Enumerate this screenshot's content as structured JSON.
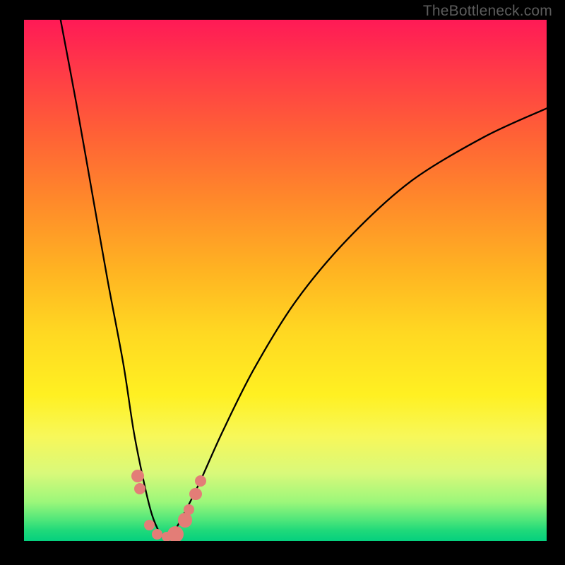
{
  "watermark": "TheBottleneck.com",
  "colors": {
    "frame": "#000000",
    "curve_stroke": "#000000",
    "marker_fill": "#e37d77",
    "gradient_top": "#ff1a56",
    "gradient_bottom": "#05d07e"
  },
  "chart_data": {
    "type": "line",
    "title": "",
    "xlabel": "",
    "ylabel": "",
    "x_range_norm": [
      0,
      100
    ],
    "y_range_norm": [
      0,
      100
    ],
    "note": "Bottleneck-style curve: y ≈ 100 at edges, y ≈ 0 at the optimum near x ≈ 27. Values are read off the normalized plot area (0 = bottom/left, 100 = top/right).",
    "series": [
      {
        "name": "curve",
        "x": [
          7,
          10,
          13,
          16,
          19,
          21,
          23,
          24.5,
          26,
          27,
          28.5,
          30.5,
          33.5,
          38,
          44,
          52,
          62,
          74,
          88,
          100
        ],
        "y": [
          100,
          84,
          67,
          50,
          34,
          21,
          11,
          5,
          1.5,
          0.5,
          1.5,
          5,
          11,
          21,
          33,
          46,
          58,
          69,
          77.5,
          83
        ]
      }
    ],
    "markers": [
      {
        "x": 21.8,
        "y": 12.5,
        "r": 1.2
      },
      {
        "x": 22.2,
        "y": 10.0,
        "r": 1.1
      },
      {
        "x": 24.0,
        "y": 3.0,
        "r": 1.0
      },
      {
        "x": 25.5,
        "y": 1.3,
        "r": 1.0
      },
      {
        "x": 27.3,
        "y": 0.8,
        "r": 1.0
      },
      {
        "x": 29.0,
        "y": 1.3,
        "r": 1.6
      },
      {
        "x": 30.8,
        "y": 4.0,
        "r": 1.4
      },
      {
        "x": 31.6,
        "y": 6.0,
        "r": 1.0
      },
      {
        "x": 32.8,
        "y": 9.0,
        "r": 1.2
      },
      {
        "x": 33.8,
        "y": 11.5,
        "r": 1.1
      }
    ]
  }
}
